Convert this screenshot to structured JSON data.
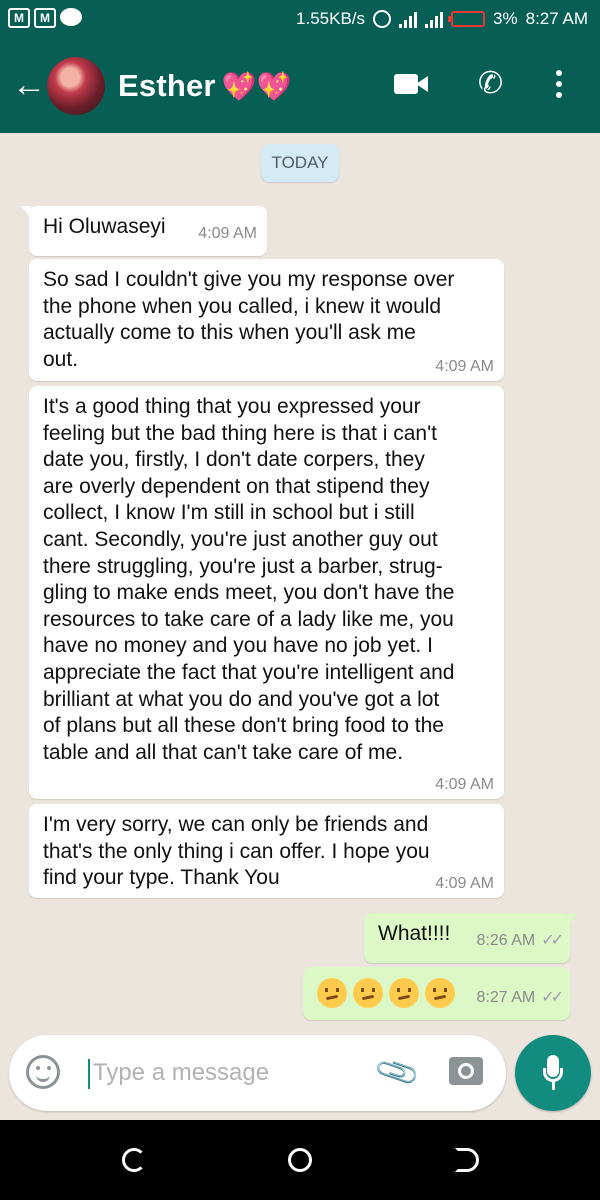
{
  "status_bar": {
    "net_speed": "1.55KB/s",
    "battery_pct": "3%",
    "time": "8:27 AM",
    "left_icons": [
      "gmail-icon",
      "gmail-icon",
      "chat-bubble-icon"
    ]
  },
  "header": {
    "contact_name": "Esther",
    "name_emoji": "💖💖"
  },
  "chat": {
    "date_label": "TODAY",
    "messages": [
      {
        "dir": "in",
        "text": "Hi Oluwaseyi",
        "time": "4:09 AM"
      },
      {
        "dir": "in",
        "lines": [
          "So sad I couldn't give you my response over",
          "the phone when you called, i knew it would",
          "actually come to this when you'll ask me",
          "out."
        ],
        "time": "4:09 AM"
      },
      {
        "dir": "in",
        "lines": [
          "It's a good thing that you expressed your",
          "feeling but the bad thing here is that i can't",
          "date you, firstly, I don't date corpers, they",
          "are overly dependent on that stipend they",
          "collect, I know I'm still in school but i still",
          "cant. Secondly, you're just another guy out",
          "there struggling, you're just a barber, strug-",
          "gling to make ends meet, you don't have the",
          "resources to take care of a lady like me, you",
          "have no money and you have no job yet. I",
          "appreciate the fact that you're intelligent and",
          "brilliant at what you do and you've got a lot",
          "of plans but all these don't bring food to the",
          "table and all that can't take care of me."
        ],
        "time": "4:09 AM"
      },
      {
        "dir": "in",
        "lines": [
          "I'm very sorry, we can only be friends and",
          "that's the only thing i can offer. I hope you",
          "find your type. Thank You"
        ],
        "time": "4:09 AM"
      },
      {
        "dir": "out",
        "text": "What!!!!",
        "time": "8:26 AM"
      },
      {
        "dir": "out",
        "emoji_count": 4,
        "time": "8:27 AM"
      }
    ]
  },
  "composer": {
    "placeholder": "Type a message"
  },
  "colors": {
    "header": "#075e54",
    "accent": "#128c7e",
    "outgoing_bubble": "#dcf8c6",
    "chat_bg": "#ece5dd"
  }
}
